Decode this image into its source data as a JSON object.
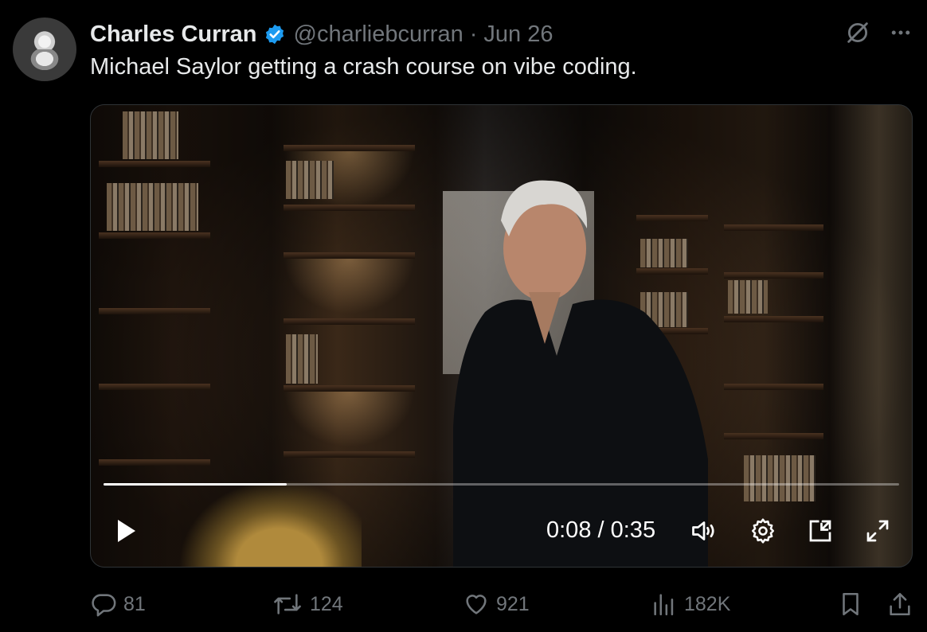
{
  "tweet": {
    "author_name": "Charles Curran",
    "handle": "@charliebcurran",
    "separator": "·",
    "date": "Jun 26",
    "text": "Michael Saylor getting a crash course on vibe coding."
  },
  "video": {
    "current_time": "0:08",
    "time_separator": " / ",
    "duration": "0:35",
    "progress_fraction": 0.23
  },
  "actions": {
    "replies": "81",
    "reposts": "124",
    "likes": "921",
    "views": "182K"
  },
  "colors": {
    "background": "#000000",
    "text": "#e7e9ea",
    "muted": "#71767b",
    "verified": "#1d9bf0"
  },
  "icons": [
    "verified-badge-icon",
    "grok-icon",
    "more-icon",
    "play-icon",
    "volume-icon",
    "settings-icon",
    "pip-icon",
    "fullscreen-icon",
    "reply-icon",
    "repost-icon",
    "like-icon",
    "views-icon",
    "bookmark-icon",
    "share-icon"
  ]
}
